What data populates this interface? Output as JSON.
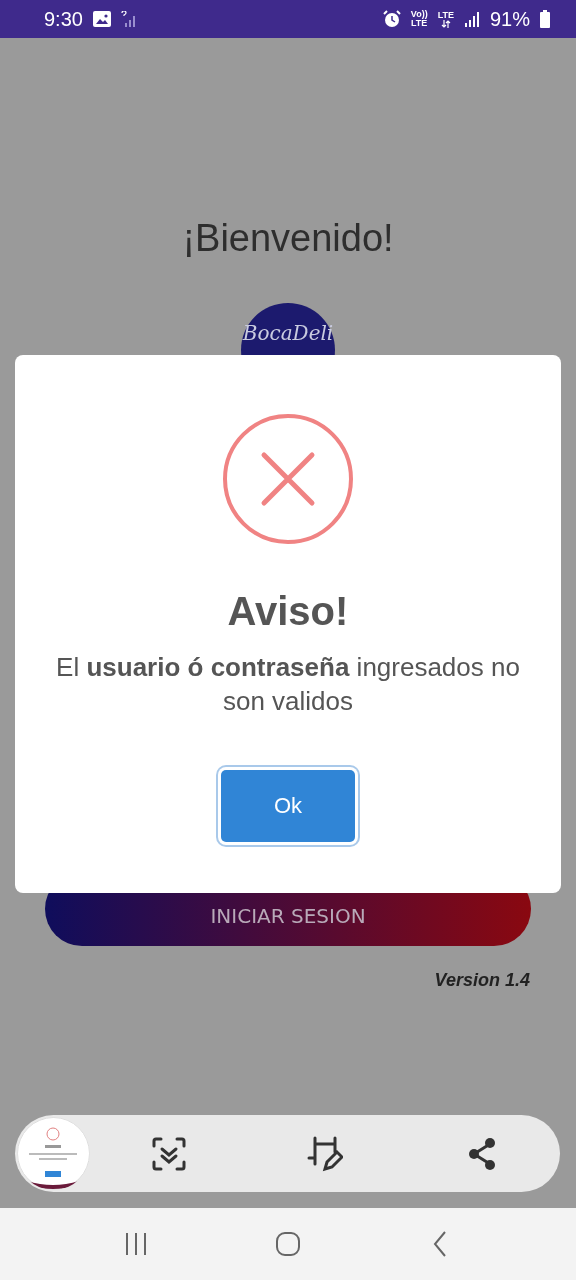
{
  "status_bar": {
    "time": "9:30",
    "network_labels": [
      {
        "top": "Vo))",
        "bottom": "LTE"
      },
      {
        "top": "LTE"
      }
    ],
    "battery": "91%"
  },
  "title": "¡Bienvenido!",
  "logo": {
    "text": "BocaDeli"
  },
  "login_button": "INICIAR SESION",
  "version": "Version 1.4",
  "dialog": {
    "title": "Aviso!",
    "message": "El **usuario ó contraseña** ingresados no son validos",
    "button": "Ok"
  }
}
